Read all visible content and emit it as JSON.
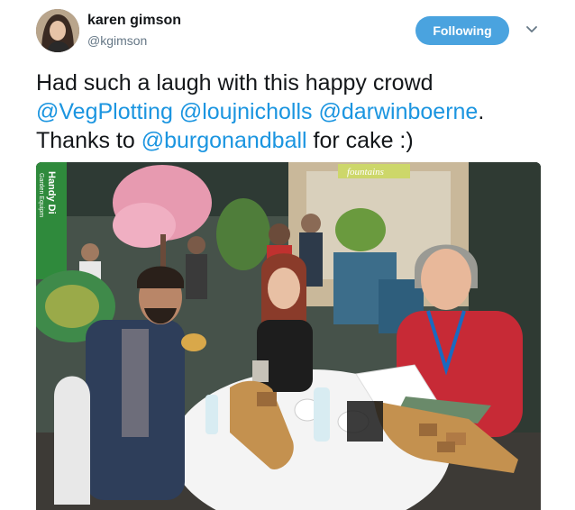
{
  "author": {
    "name": "karen gimson",
    "handle": "@kgimson"
  },
  "follow_button": {
    "label": "Following"
  },
  "tweet": {
    "part1": "Had such a laugh with this happy crowd",
    "mention1": "@VegPlotting",
    "mention2": "@loujnicholls",
    "mention3": "@darwinboerne",
    "part2": ". Thanks to ",
    "mention4": "@burgonandball",
    "part3": " for cake :)"
  },
  "photo": {
    "banner_text": "Handy Di",
    "banner_sub": "Garden Equipm",
    "sign_text": "fountains"
  },
  "colors": {
    "accent": "#1b95e0",
    "follow_bg": "#4aa3df",
    "handle": "#657786"
  },
  "icons": [
    "chevron-down-icon"
  ]
}
